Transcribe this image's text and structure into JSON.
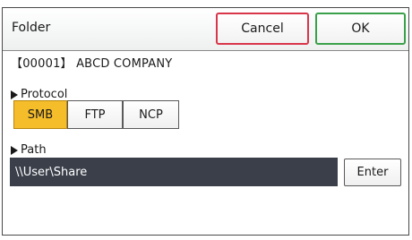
{
  "dialog": {
    "title": "Folder",
    "cancel_label": "Cancel",
    "ok_label": "OK"
  },
  "destination": {
    "label": "【00001】 ABCD COMPANY"
  },
  "protocol": {
    "heading": "Protocol",
    "options": [
      "SMB",
      "FTP",
      "NCP"
    ],
    "selected": "SMB",
    "selected_color": "#f6bd2b"
  },
  "path": {
    "heading": "Path",
    "value": "\\\\User\\Share",
    "enter_label": "Enter",
    "field_color": "#3a3f4a"
  },
  "icons": [
    "triangle-right-icon"
  ]
}
